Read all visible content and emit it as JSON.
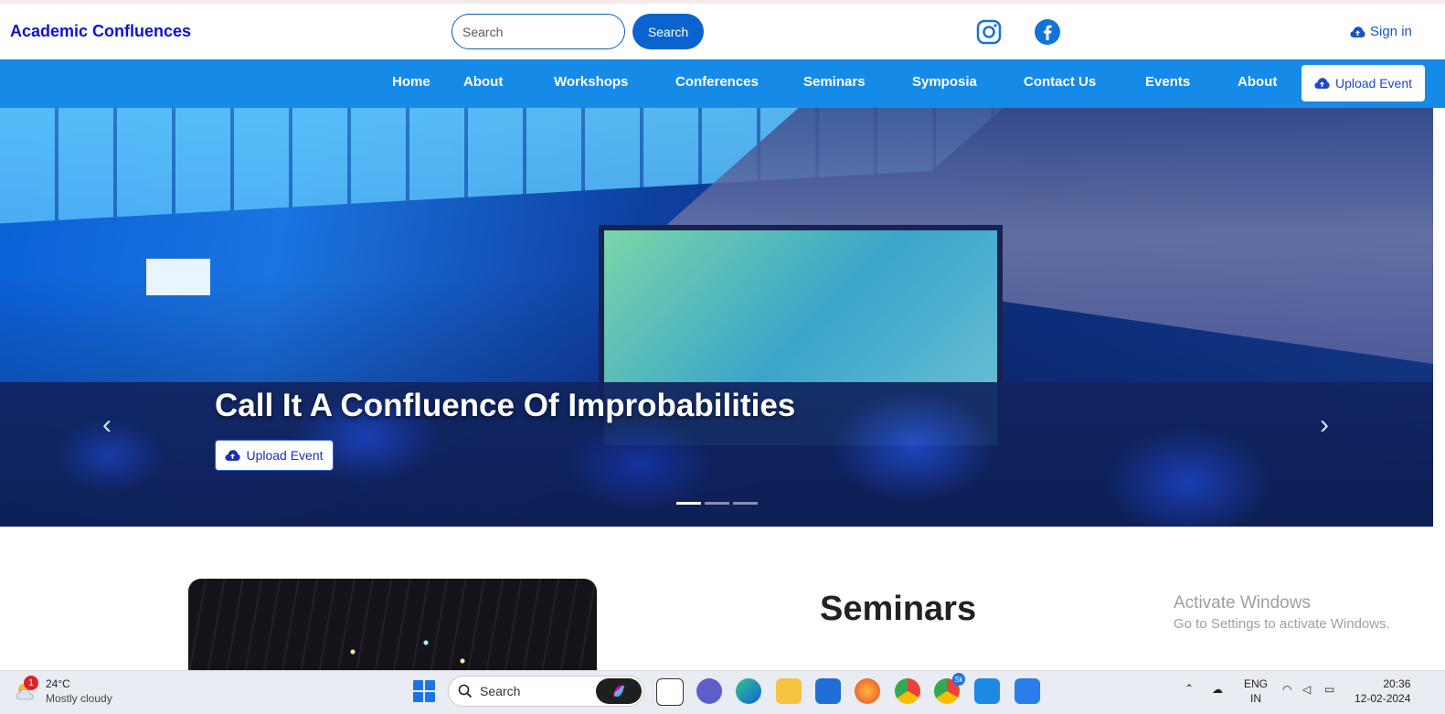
{
  "site": {
    "brand": "Academic Confluences",
    "search_placeholder": "Search",
    "search_button": "Search",
    "sign_in": "Sign in"
  },
  "nav": {
    "items": [
      "Home",
      "About",
      "Workshops",
      "Conferences",
      "Seminars",
      "Symposia",
      "Contact Us",
      "Events",
      "About"
    ],
    "upload_label": "Upload Event"
  },
  "hero": {
    "title": "Call It A Confluence Of Improbabilities",
    "upload_label": "Upload Event",
    "prev_glyph": "‹",
    "next_glyph": "›",
    "indicator_count": 3,
    "active_indicator": 0
  },
  "section": {
    "title": "Seminars"
  },
  "watermark": {
    "line1": "Activate Windows",
    "line2": "Go to Settings to activate Windows."
  },
  "taskbar": {
    "weather_temp": "24°C",
    "weather_desc": "Mostly cloudy",
    "weather_badge": "1",
    "search_label": "Search",
    "lang_1": "ENG",
    "lang_2": "IN",
    "time": "20:36",
    "date": "12-02-2024",
    "chrome_badge": "Sk"
  },
  "colors": {
    "brand": "#1010d8",
    "navbar": "#168ae7",
    "primary_button": "#0a63cf"
  }
}
